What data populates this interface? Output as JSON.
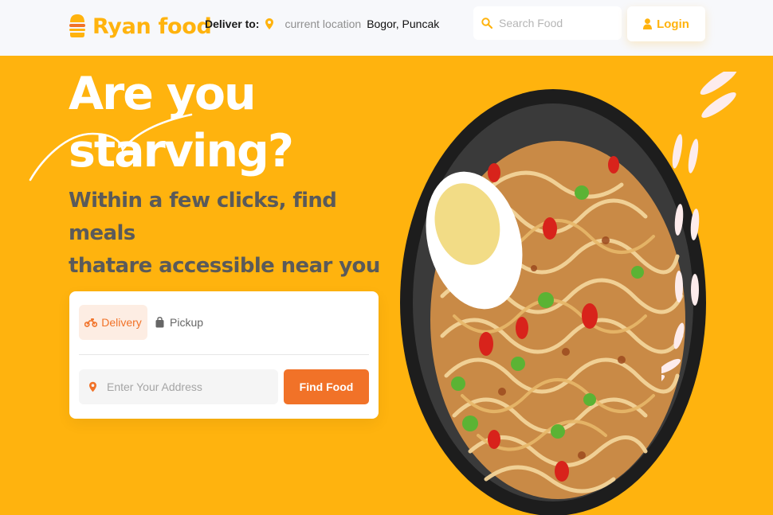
{
  "header": {
    "brand": "Ryan food",
    "deliver_label": "Deliver to:",
    "current_location": "current location",
    "city": "Bogor, Puncak",
    "search_placeholder": "Search Food",
    "login_label": "Login"
  },
  "hero": {
    "title_line1": "Are you",
    "title_line2": "starving?",
    "subtitle_line1": "Within a few clicks, find meals",
    "subtitle_line2": "thatare accessible near you"
  },
  "order_card": {
    "tabs": [
      {
        "label": "Delivery",
        "active": true
      },
      {
        "label": "Pickup",
        "active": false
      }
    ],
    "address_placeholder": "Enter Your Address",
    "find_label": "Find Food"
  },
  "colors": {
    "brand_yellow": "#FFB30E",
    "accent_orange": "#F17228",
    "header_bg": "#F7F8FB"
  }
}
